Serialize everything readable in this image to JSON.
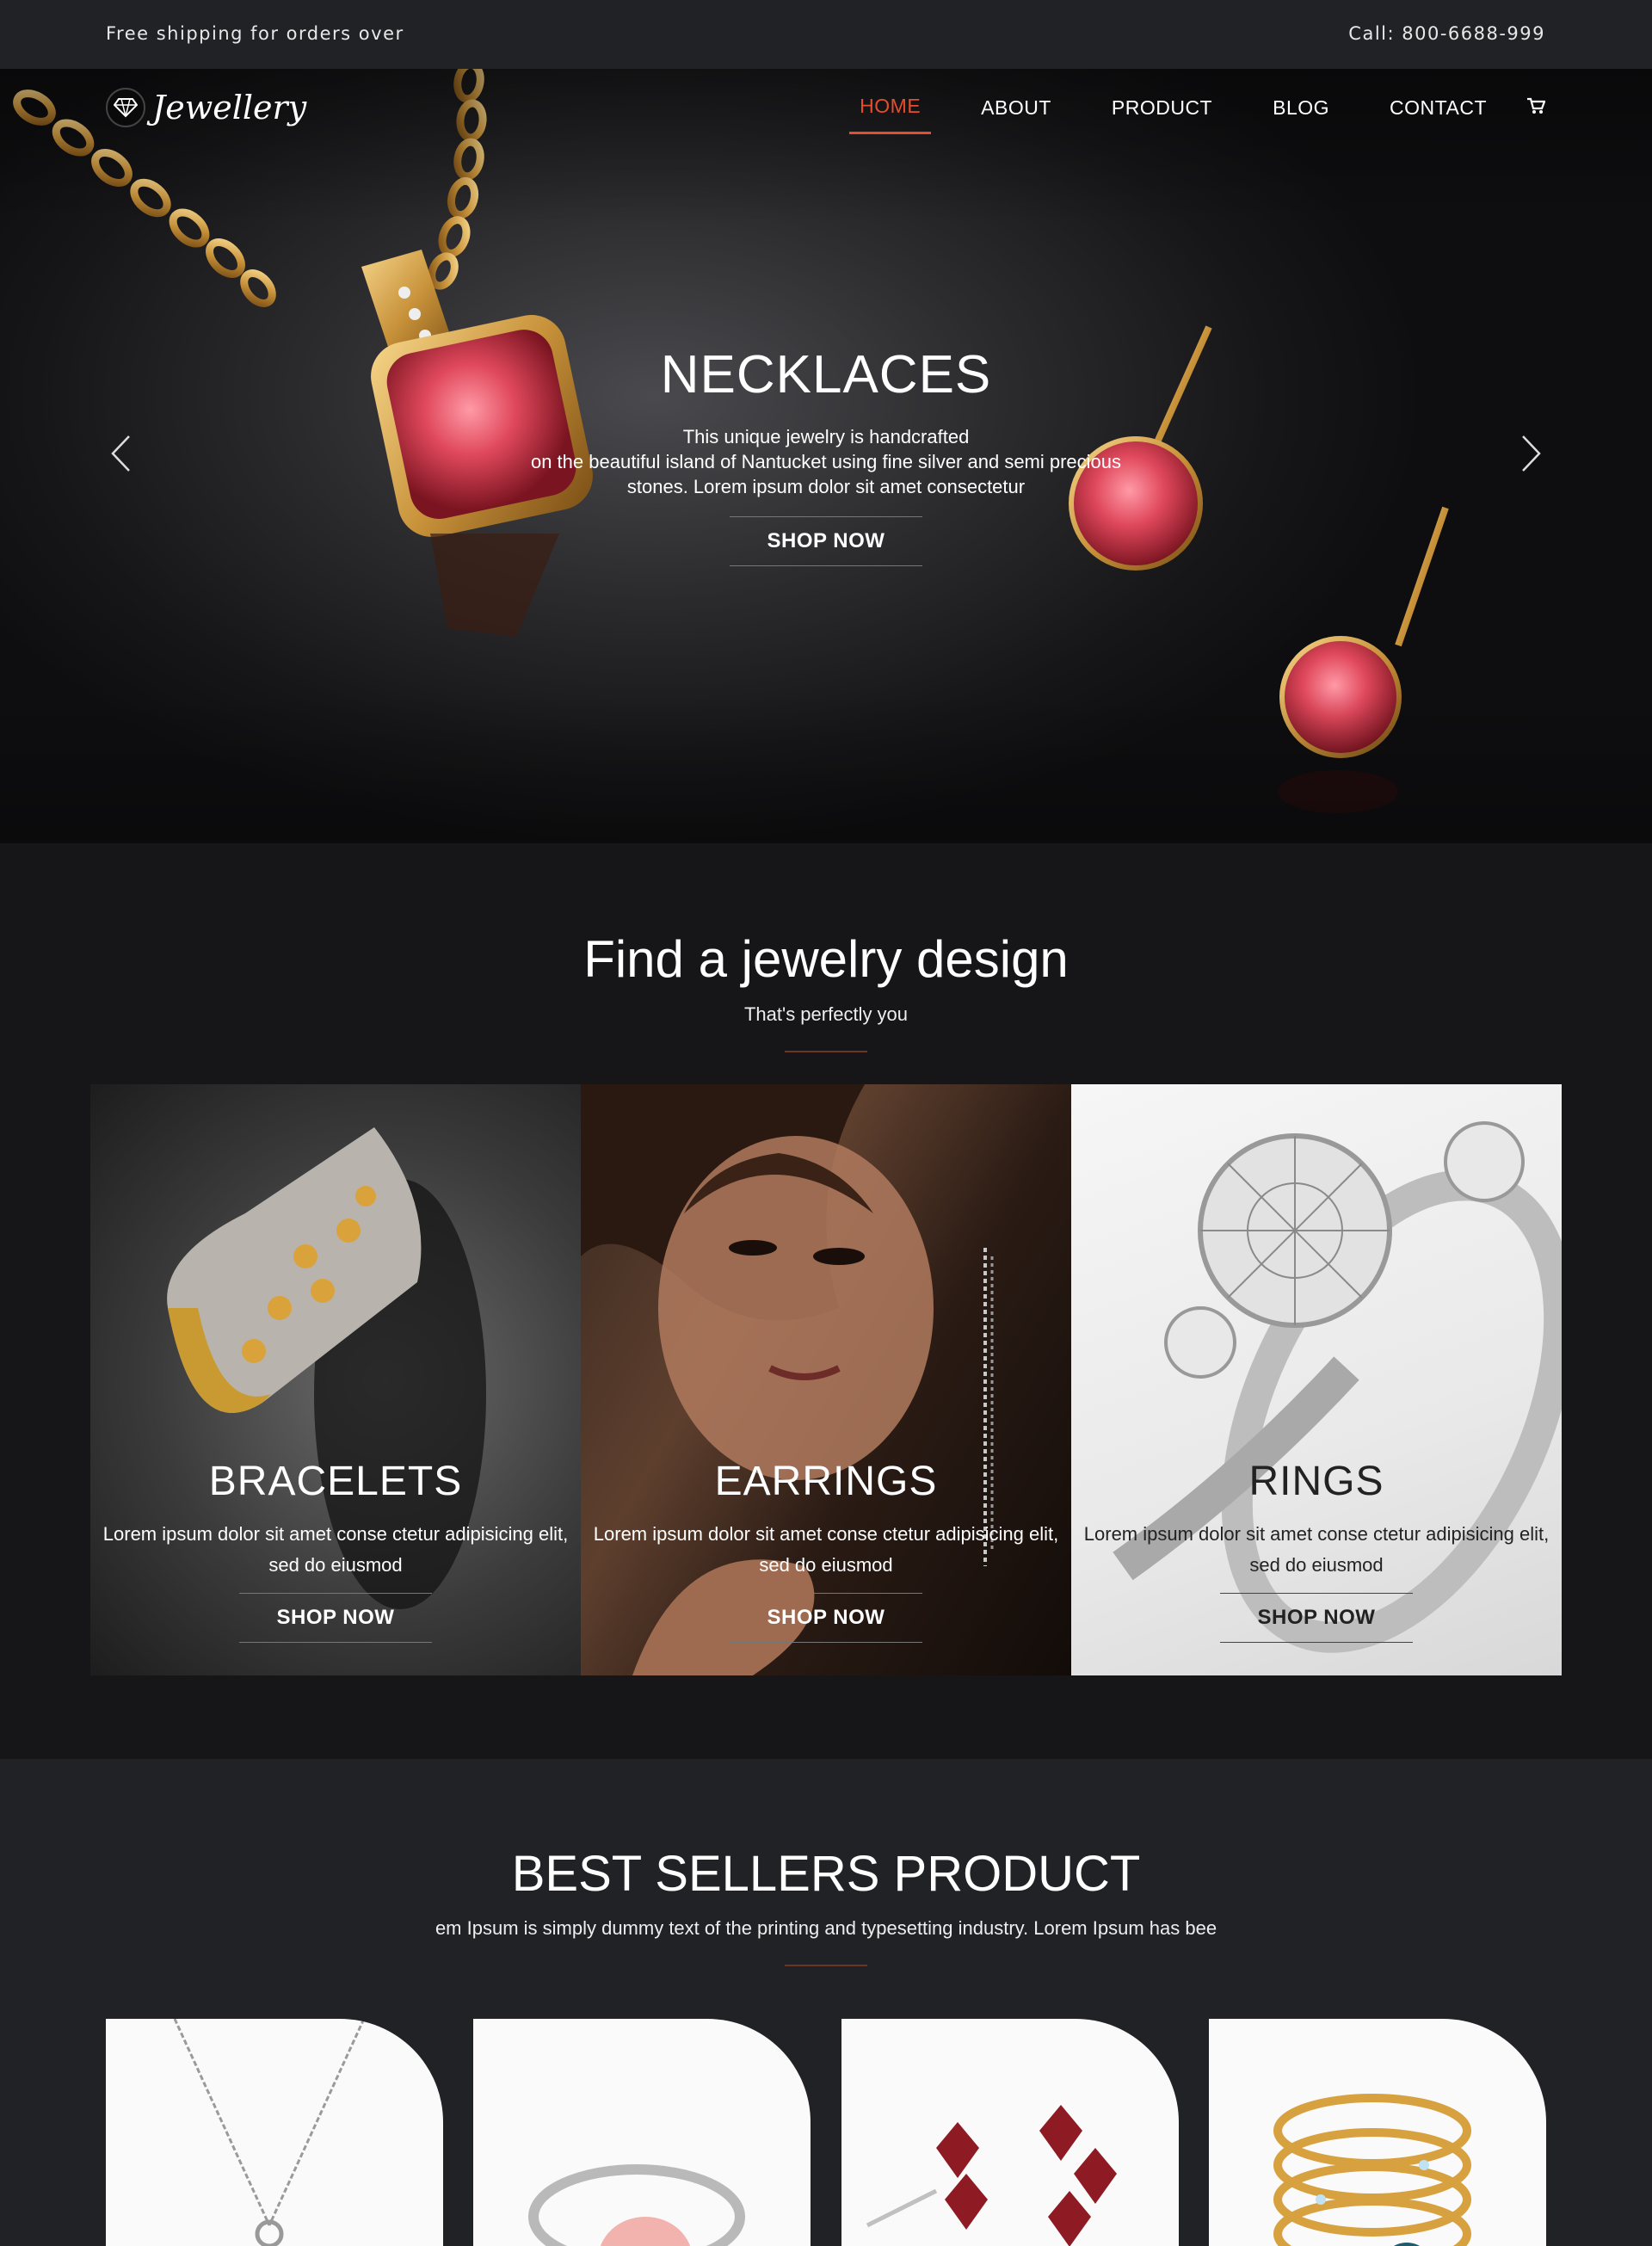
{
  "topbar": {
    "shipping_text": "Free shipping for orders over",
    "call_text": "Call: 800-6688-999"
  },
  "logo": {
    "text": "Jewellery",
    "icon": "diamond-icon"
  },
  "nav": {
    "items": [
      "HOME",
      "ABOUT",
      "PRODUCT",
      "BLOG",
      "CONTACT"
    ],
    "active": "HOME",
    "cart_icon": "cart-icon"
  },
  "hero": {
    "title": "NECKLACES",
    "text_line1": "This unique jewelry is handcrafted",
    "text_line2": "on the beautiful island of Nantucket using fine silver and semi precious",
    "text_line3": "stones. Lorem ipsum dolor sit amet consectetur",
    "button": "SHOP NOW",
    "prev_icon": "chevron-left-icon",
    "next_icon": "chevron-right-icon"
  },
  "find": {
    "title": "Find a jewelry design",
    "subtitle": "That's perfectly you",
    "cards": [
      {
        "name": "BRACELETS",
        "desc_line1": "Lorem ipsum dolor sit amet conse ctetur adipisicing elit,",
        "desc_line2": "sed do eiusmod",
        "button": "SHOP NOW"
      },
      {
        "name": "EARRINGS",
        "desc_line1": "Lorem ipsum dolor sit amet conse ctetur adipisicing elit,",
        "desc_line2": "sed do eiusmod",
        "button": "SHOP NOW"
      },
      {
        "name": "RINGS",
        "desc_line1": "Lorem ipsum dolor sit amet conse ctetur adipisicing elit,",
        "desc_line2": "sed do eiusmod",
        "button": "SHOP NOW"
      }
    ]
  },
  "best": {
    "title": "BEST SELLERS PRODUCT",
    "subtitle": "em Ipsum is simply dummy text of the printing and typesetting industry. Lorem Ipsum has bee"
  },
  "colors": {
    "accent": "#e44d2e",
    "divider": "#6b3628",
    "dark_bg": "#161618",
    "bar_bg": "#202226"
  }
}
